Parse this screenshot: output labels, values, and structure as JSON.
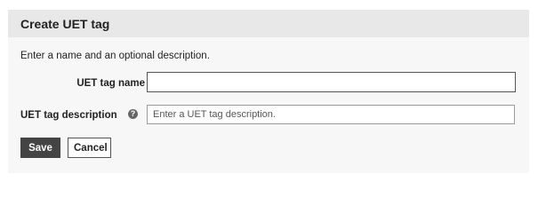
{
  "dialog": {
    "title": "Create UET tag",
    "intro": "Enter a name and an optional description."
  },
  "form": {
    "name_label": "UET tag name",
    "name_value": "",
    "description_label": "UET tag description",
    "description_help_glyph": "?",
    "description_value": "",
    "description_placeholder": "Enter a UET tag description."
  },
  "actions": {
    "save_label": "Save",
    "cancel_label": "Cancel"
  },
  "icons": {
    "help": "question-circle-icon"
  },
  "colors": {
    "header_bg": "#e8e8e8",
    "panel_bg": "#f7f7f7",
    "primary_button": "#444444"
  }
}
